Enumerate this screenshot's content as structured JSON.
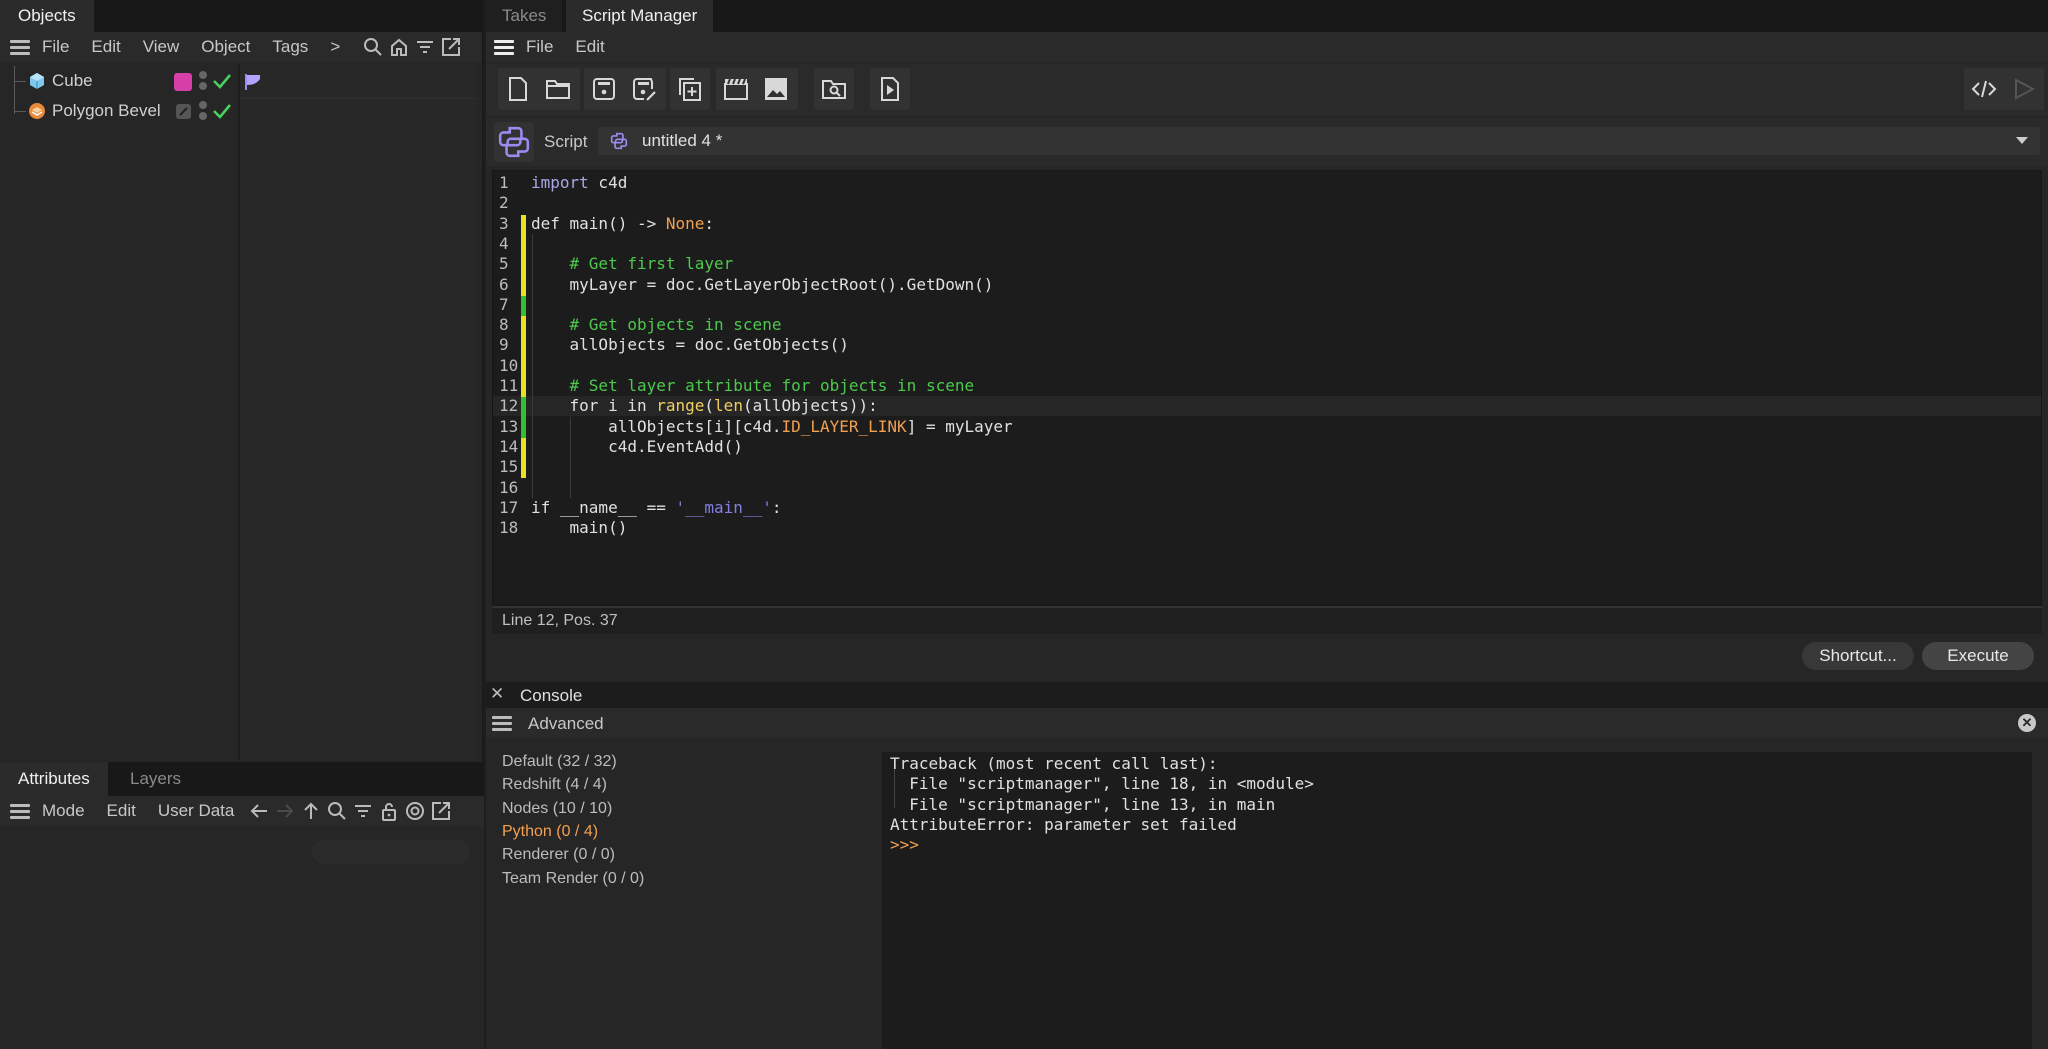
{
  "left_panel": {
    "objects_tab": "Objects",
    "menu": [
      "File",
      "Edit",
      "View",
      "Object",
      "Tags"
    ],
    "more_label": ">",
    "objects": [
      {
        "name": "Cube",
        "icon": "cube-icon",
        "tag_color": "#d63fa8",
        "enabled": true
      },
      {
        "name": "Polygon Bevel",
        "icon": "bevel-deformer-icon",
        "enabled": true
      }
    ],
    "attributes_tabs": [
      "Attributes",
      "Layers"
    ],
    "attributes_menu": [
      "Mode",
      "Edit",
      "User Data"
    ]
  },
  "right_panel": {
    "tabs": [
      "Takes",
      "Script Manager"
    ],
    "active_tab": "Script Manager",
    "menu": [
      "File",
      "Edit"
    ],
    "toolbar_icons": [
      "new-file-icon",
      "open-folder-icon",
      "save-icon",
      "save-as-icon",
      "duplicate-icon",
      "clapper-icon",
      "image-icon",
      "browse-folder-icon",
      "run-file-icon"
    ],
    "script_label": "Script",
    "script_name": "untitled 4 *",
    "code_lines": [
      "import c4d",
      "",
      "def main() -> None:",
      "",
      "    # Get first layer",
      "    myLayer = doc.GetLayerObjectRoot().GetDown()",
      "",
      "    # Get objects in scene",
      "    allObjects = doc.GetObjects()",
      "",
      "    # Set layer attribute for objects in scene",
      "    for i in range(len(allObjects)):",
      "        allObjects[i][c4d.ID_LAYER_LINK] = myLayer",
      "        c4d.EventAdd()",
      "",
      "",
      "if __name__ == '__main__':",
      "    main()"
    ],
    "current_line": 12,
    "status": "Line 12, Pos. 37",
    "shortcut_button": "Shortcut...",
    "execute_button": "Execute"
  },
  "console": {
    "title": "Console",
    "mode": "Advanced",
    "filters": [
      {
        "label": "Default (32 / 32)",
        "active": false
      },
      {
        "label": "Redshift (4 / 4)",
        "active": false
      },
      {
        "label": "Nodes (10 / 10)",
        "active": false
      },
      {
        "label": "Python (0 / 4)",
        "active": true
      },
      {
        "label": "Renderer (0 / 0)",
        "active": false
      },
      {
        "label": "Team Render  (0 / 0)",
        "active": false
      }
    ],
    "output": [
      "Traceback (most recent call last):",
      "  File \"scriptmanager\", line 18, in <module>",
      "  File \"scriptmanager\", line 13, in main",
      "AttributeError: parameter set failed"
    ],
    "prompt": ">>>"
  },
  "colors": {
    "accent_orange": "#f0a050",
    "comment_green": "#4ec84e",
    "modified_yellow": "#e8e020",
    "saved_green": "#30c030",
    "python_purple": "#9a8cf0"
  }
}
